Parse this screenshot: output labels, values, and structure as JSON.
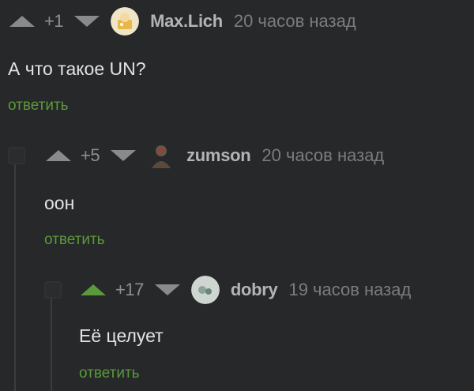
{
  "comments": [
    {
      "score": "+1",
      "username": "Max.Lich",
      "time": "20 часов назад",
      "text": "А что такое UN?",
      "reply": "ответить",
      "upvoted": false
    },
    {
      "score": "+5",
      "username": "zumson",
      "time": "20 часов назад",
      "text": "оон",
      "reply": "ответить",
      "upvoted": false
    },
    {
      "score": "+17",
      "username": "dobry",
      "time": "19 часов назад",
      "text": "Её целует",
      "reply": "ответить",
      "upvoted": true
    }
  ],
  "colors": {
    "background": "#26282a",
    "reply_green": "#5b9a3a",
    "upvoted_green": "#5b9a3a",
    "vote_gray": "#888a8c"
  },
  "icons": {
    "vote_up": "triangle-up-icon",
    "vote_down": "triangle-down-icon",
    "avatar": "avatar-image"
  }
}
